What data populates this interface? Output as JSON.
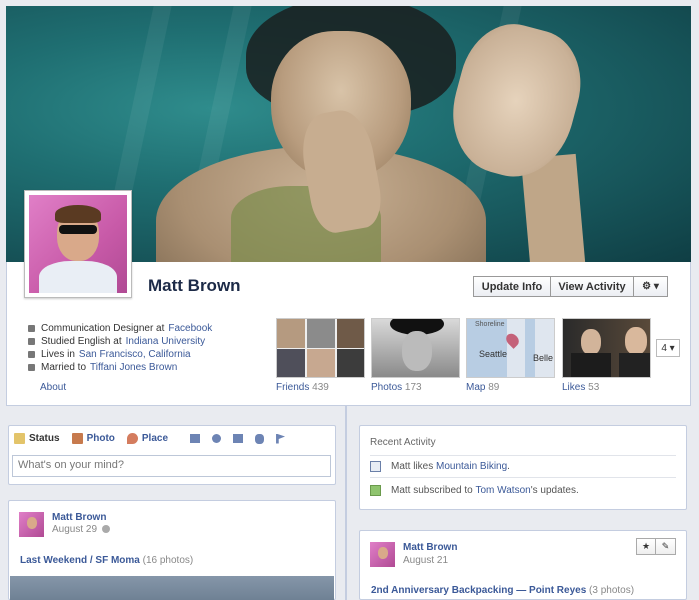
{
  "cover": {},
  "profile": {
    "name": "Matt Brown"
  },
  "actions": {
    "update_info": "Update Info",
    "view_activity": "View Activity",
    "settings_glyph": "⚙ ▾"
  },
  "about": {
    "items": [
      {
        "icon": "briefcase-icon",
        "text": "Communication Designer at ",
        "link": "Facebook"
      },
      {
        "icon": "graduation-cap-icon",
        "text": "Studied English at ",
        "link": "Indiana University"
      },
      {
        "icon": "house-icon",
        "text": "Lives in ",
        "link": "San Francisco, California"
      },
      {
        "icon": "heart-icon",
        "text": "Married to ",
        "link": "Tiffani Jones Brown"
      }
    ],
    "label": "About"
  },
  "tiles": {
    "friends": {
      "label": "Friends",
      "count": "439"
    },
    "photos": {
      "label": "Photos",
      "count": "173"
    },
    "map": {
      "label": "Map",
      "count": "89",
      "places": [
        "Shoreline",
        "Seattle",
        "Belle"
      ]
    },
    "likes": {
      "label": "Likes",
      "count": "53"
    },
    "more_label": "4 ▾"
  },
  "composer": {
    "tabs": {
      "status": "Status",
      "photo": "Photo",
      "place": "Place"
    },
    "extra_icons": [
      "building-icon",
      "heart-icon",
      "house-icon",
      "hand-icon",
      "flag-icon"
    ],
    "placeholder": "What's on your mind?"
  },
  "posts": [
    {
      "author": "Matt Brown",
      "date": "August 29",
      "title": "Last Weekend / SF Moma",
      "meta": "(16 photos)"
    },
    {
      "author": "Matt Brown",
      "date": "August 21",
      "title": "2nd Anniversary Backpacking — Point Reyes",
      "meta": "(3 photos)"
    }
  ],
  "activity": {
    "title": "Recent Activity",
    "rows": [
      {
        "icon": "like-icon",
        "prefix": "Matt likes ",
        "link": "Mountain Biking",
        "suffix": "."
      },
      {
        "icon": "subscribe-icon",
        "prefix": "Matt subscribed to ",
        "link": "Tom Watson",
        "suffix": "'s updates."
      }
    ]
  },
  "colors": {
    "link": "#3b5998",
    "background": "#e9ebf0",
    "border": "#c4cde0"
  }
}
